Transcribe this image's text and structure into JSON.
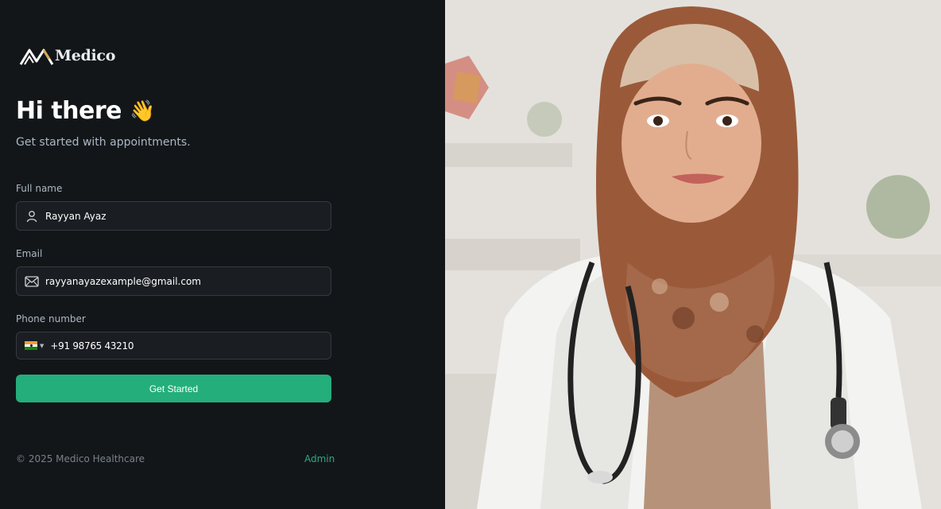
{
  "brand": {
    "name": "Medico",
    "accent": "#24ae7c"
  },
  "hero": {
    "title": "Hi there",
    "emoji": "👋",
    "subtitle": "Get started with appointments."
  },
  "form": {
    "full_name": {
      "label": "Full name",
      "value": "Rayyan Ayaz",
      "icon": "user-icon"
    },
    "email": {
      "label": "Email",
      "value": "rayyanayazexample@gmail.com",
      "icon": "mail-icon"
    },
    "phone": {
      "label": "Phone number",
      "value": "+91 98765 43210",
      "country": "India",
      "icon": "india-flag-icon"
    },
    "submit_label": "Get Started"
  },
  "footer": {
    "copyright": "© 2025 Medico Healthcare",
    "admin_link": "Admin"
  }
}
